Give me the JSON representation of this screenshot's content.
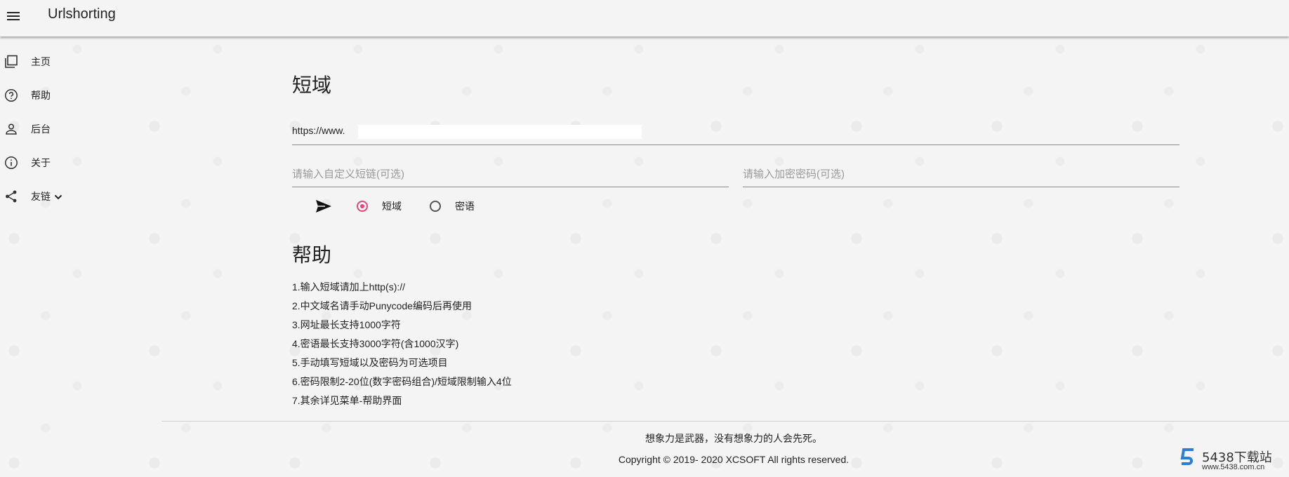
{
  "app": {
    "title": "Urlshorting"
  },
  "icons": {
    "menu": "hamburger-icon"
  },
  "sidebar": {
    "items": [
      {
        "label": "主页",
        "icon": "copy-pages-icon"
      },
      {
        "label": "帮助",
        "icon": "help-circle-icon"
      },
      {
        "label": "后台",
        "icon": "person-icon"
      },
      {
        "label": "关于",
        "icon": "info-icon"
      },
      {
        "label": "友链",
        "icon": "share-icon",
        "dropdown": "chevron-down-icon"
      }
    ]
  },
  "shorten": {
    "title": "短域",
    "url_value": "https://www.",
    "custom_placeholder": "请输入自定义短链(可选)",
    "password_placeholder": "请输入加密密码(可选)",
    "mode_options": [
      "短域",
      "密语"
    ],
    "selected_mode": "短域",
    "accent_color": "#e7457a"
  },
  "help": {
    "title": "帮助",
    "items": [
      "1.输入短域请加上http(s)://",
      "2.中文域名请手动Punycode编码后再使用",
      "3.网址最长支持1000字符",
      "4.密语最长支持3000字符(含1000汉字)",
      "5.手动填写短域以及密码为可选项目",
      "6.密码限制2-20位(数字密码组合)/短域限制输入4位",
      "7.其余详见菜单-帮助界面"
    ]
  },
  "footer": {
    "motto": "想象力是武器，没有想象力的人会先死。",
    "copyright": "Copyright © 2019- 2020 XCSOFT All rights reserved."
  },
  "watermark": {
    "name": "5438下载站",
    "url": "www.5438.com.cn"
  }
}
